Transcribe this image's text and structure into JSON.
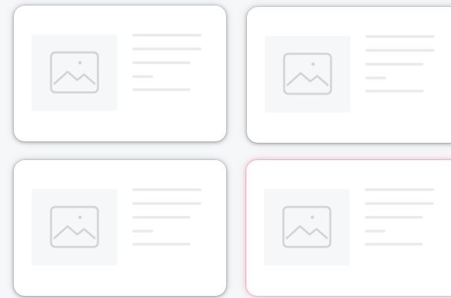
{
  "gallery": {
    "cards": [
      {
        "id": "card-1",
        "state": "default"
      },
      {
        "id": "card-2",
        "state": "default"
      },
      {
        "id": "card-3",
        "state": "default"
      },
      {
        "id": "card-4",
        "state": "selected"
      }
    ],
    "placeholder_icon": "image-placeholder-icon",
    "colors": {
      "page_background": "#f6f7f9",
      "card_background": "#ffffff",
      "thumbnail_background": "#f6f7f9",
      "icon_stroke": "#d4d4d6",
      "text_line": "#ebebec",
      "selected_glow": "#f08ca0"
    }
  }
}
